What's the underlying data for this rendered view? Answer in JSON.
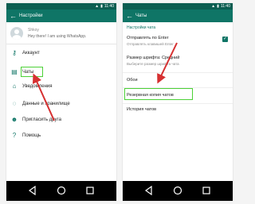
{
  "left": {
    "statusbar": {
      "time": "11:40"
    },
    "appbar": {
      "title": "Настройки"
    },
    "profile": {
      "name": "Shkoy",
      "status": "Hey there! I am using WhatsApp."
    },
    "menu": [
      {
        "label": "Аккаунт",
        "icon": "key-icon"
      },
      {
        "label": "Чаты",
        "icon": "chat-icon"
      },
      {
        "label": "Уведомления",
        "icon": "bell-icon"
      },
      {
        "label": "Данные и хранилище",
        "icon": "data-icon"
      },
      {
        "label": "Пригласить друга",
        "icon": "people-icon"
      },
      {
        "label": "Помощь",
        "icon": "help-icon"
      }
    ]
  },
  "right": {
    "statusbar": {
      "time": "11:40"
    },
    "appbar": {
      "title": "Чаты"
    },
    "section_header": "Настройки чата",
    "settings": {
      "enter_send": {
        "title": "Отправлять по Enter",
        "sub": "Отправлять клавишей Enter",
        "checked": true
      },
      "font_size": {
        "title": "Размер шрифта: Средний",
        "sub": "Выберите размер шрифта чата"
      },
      "wallpaper": {
        "title": "Обои"
      },
      "backup": {
        "title": "Резервная копия чатов"
      },
      "history": {
        "title": "История чатов"
      }
    }
  },
  "colors": {
    "statusbar": "#0b5d50",
    "appbar": "#0f7566",
    "highlight": "#4cd137",
    "annotation_arrow": "#d63031"
  }
}
